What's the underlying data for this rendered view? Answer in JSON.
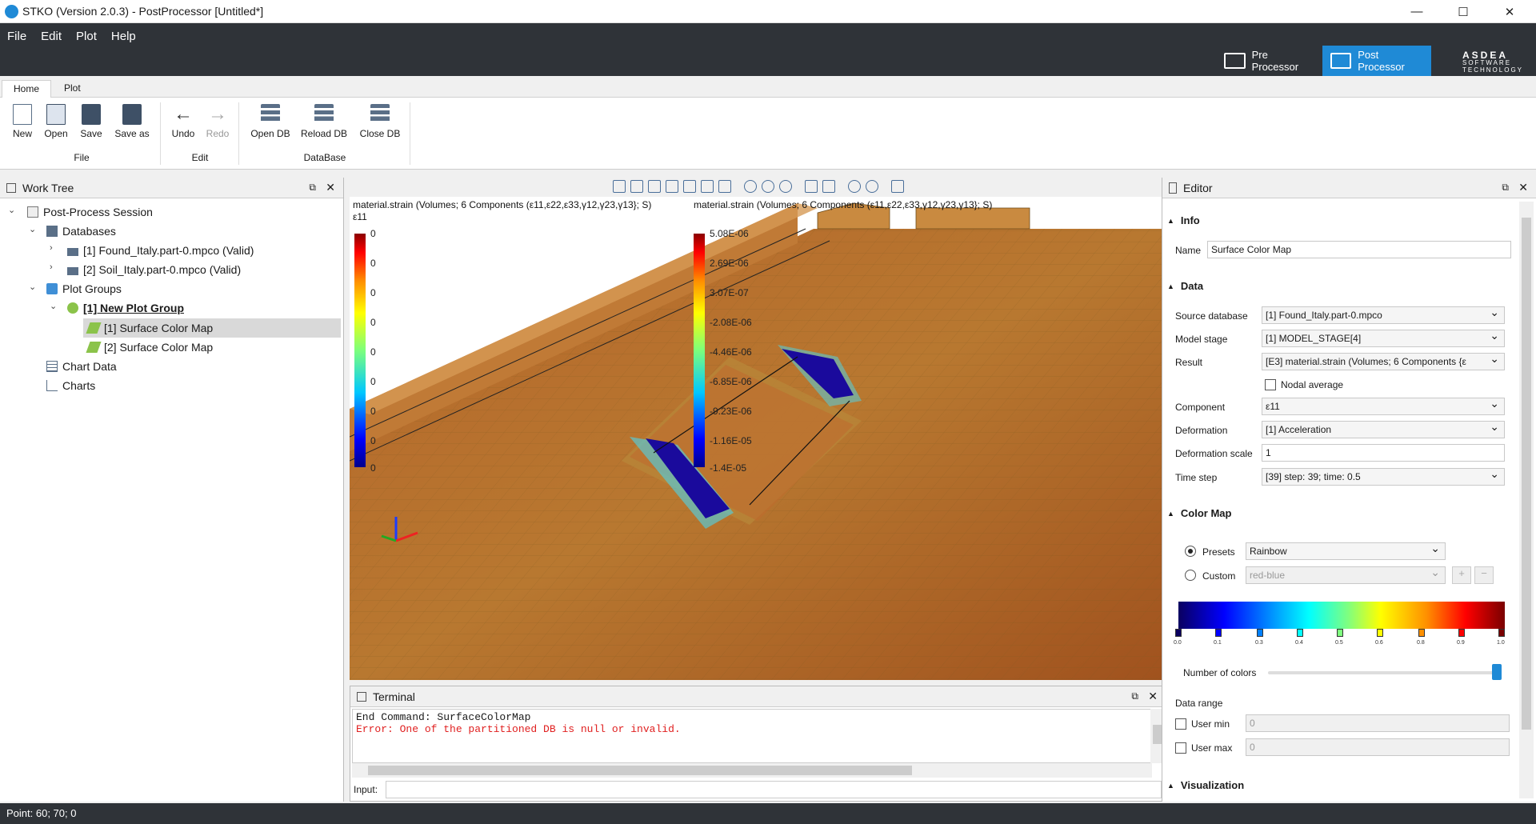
{
  "window": {
    "title": "STKO (Version 2.0.3) - PostProcessor [Untitled*]",
    "controls": {
      "minimize": "—",
      "maximize": "☐",
      "close": "✕"
    }
  },
  "menu": [
    "File",
    "Edit",
    "Plot",
    "Help"
  ],
  "modes": {
    "pre": "Pre Processor",
    "post": "Post Processor"
  },
  "logo": {
    "line1": "ASDEA",
    "line2": "SOFTWARE",
    "line3": "TECHNOLOGY"
  },
  "ribbon": {
    "tabs": [
      "Home",
      "Plot"
    ],
    "file": {
      "label": "File",
      "new": "New",
      "open": "Open",
      "save": "Save",
      "save_as": "Save as"
    },
    "edit": {
      "label": "Edit",
      "undo": "Undo",
      "redo": "Redo"
    },
    "database": {
      "label": "DataBase",
      "open_db": "Open DB",
      "reload_db": "Reload DB",
      "close_db": "Close DB"
    }
  },
  "worktree": {
    "title": "Work Tree",
    "items": {
      "session": "Post-Process Session",
      "databases": "Databases",
      "db1": "[1] Found_Italy.part-0.mpco (Valid)",
      "db2": "[2] Soil_Italy.part-0.mpco (Valid)",
      "plot_groups": "Plot Groups",
      "group1": "[1] New Plot Group",
      "scm1": "[1] Surface Color Map",
      "scm2": "[2] Surface Color Map",
      "chart_data": "Chart Data",
      "charts": "Charts"
    }
  },
  "viewport": {
    "legend_left": {
      "title": "material.strain (Volumes; 6 Components (ε11,ε22,ε33,γ12,γ23,γ13}; S)",
      "component": "ε11",
      "labels": [
        "0",
        "0",
        "0",
        "0",
        "0",
        "0",
        "0",
        "0",
        "0"
      ]
    },
    "legend_right": {
      "title": "material.strain (Volumes; 6 Components (ε11,ε22,ε33,γ12,γ23,γ13}; S)",
      "labels": [
        "5.08E-06",
        "2.69E-06",
        "3.07E-07",
        "-2.08E-06",
        "-4.46E-06",
        "-6.85E-06",
        "-9.23E-06",
        "-1.16E-05",
        "-1.4E-05"
      ]
    }
  },
  "terminal": {
    "title": "Terminal",
    "line1": "End Command: SurfaceColorMap",
    "line2": "Error: One of the partitioned DB is null or invalid.",
    "input_label": "Input:",
    "input_value": ""
  },
  "editor": {
    "title": "Editor",
    "info": {
      "section": "Info",
      "name_label": "Name",
      "name_value": "Surface Color Map"
    },
    "data": {
      "section": "Data",
      "source_db_label": "Source database",
      "source_db_value": "[1] Found_Italy.part-0.mpco",
      "model_stage_label": "Model stage",
      "model_stage_value": "[1] MODEL_STAGE[4]",
      "result_label": "Result",
      "result_value": "[E3] material.strain (Volumes; 6 Components {ε",
      "nodal_average_label": "Nodal average",
      "component_label": "Component",
      "component_value": "ε11",
      "deformation_label": "Deformation",
      "deformation_value": "[1] Acceleration",
      "deformation_scale_label": "Deformation scale",
      "deformation_scale_value": "1",
      "time_step_label": "Time step",
      "time_step_value": "[39] step: 39; time: 0.5"
    },
    "color_map": {
      "section": "Color Map",
      "presets_label": "Presets",
      "presets_value": "Rainbow",
      "custom_label": "Custom",
      "custom_value": "red-blue",
      "ticks": [
        "0.0",
        "0.1",
        "0.3",
        "0.4",
        "0.5",
        "0.6",
        "0.8",
        "0.9",
        "1.0"
      ],
      "num_colors_label": "Number of colors",
      "data_range_label": "Data range",
      "user_min_label": "User min",
      "user_min_value": "0",
      "user_max_label": "User max",
      "user_max_value": "0"
    },
    "visualization": {
      "section": "Visualization"
    }
  },
  "status": {
    "text": "Point: 60; 70; 0"
  },
  "colors": {
    "dark": "#2f3338",
    "accent": "#1f8ad6",
    "error": "#e02020"
  }
}
